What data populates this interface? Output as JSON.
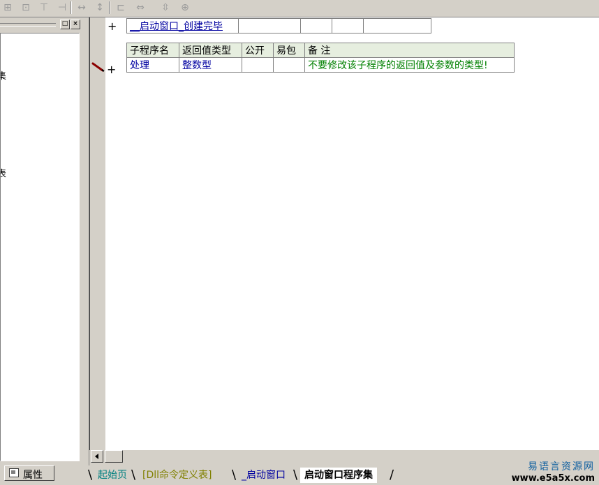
{
  "toolbar": {
    "buttons": [
      "align-left-icon",
      "align-center-icon",
      "align-top-icon",
      "align-right-icon",
      "same-width-icon",
      "same-height-icon",
      "horizontal-center-icon",
      "vertical-center-icon",
      "center-icon"
    ]
  },
  "left_panel": {
    "fragment_1": "集",
    "fragment_2": "表",
    "restore_label": "□",
    "close_label": "×"
  },
  "prop_tab": {
    "label": "属性"
  },
  "code": {
    "event_row": {
      "marker": "+",
      "name": "__启动窗口_创建完毕"
    },
    "sub_header": {
      "name": "子程序名",
      "return_type": "返回值类型",
      "public": "公开",
      "easy_pack": "易包",
      "remark": "备 注"
    },
    "sub_row": {
      "marker": "+",
      "name": "处理",
      "return_type": "整数型",
      "public": "",
      "easy_pack": "",
      "remark": "不要修改该子程序的返回值及参数的类型!"
    }
  },
  "tabs": [
    {
      "label": "起始页",
      "color": "#008080"
    },
    {
      "label": "[Dll命令定义表]",
      "color": "#808000"
    },
    {
      "label": "_启动窗口",
      "color": "#0000a0"
    },
    {
      "label": "启动窗口程序集",
      "color": "#000000",
      "active": true
    }
  ],
  "watermark": {
    "cn": "易语言资源网",
    "url": "www.e5a5x.com"
  }
}
